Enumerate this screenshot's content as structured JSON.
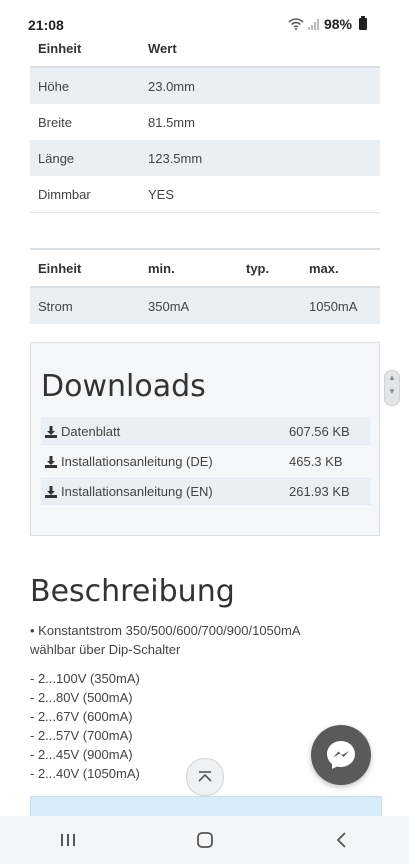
{
  "status_bar": {
    "time": "21:08",
    "battery": "98%"
  },
  "spec_table_1": {
    "headers": [
      "Einheit",
      "Wert"
    ],
    "rows": [
      [
        "Höhe",
        "23.0mm"
      ],
      [
        "Breite",
        "81.5mm"
      ],
      [
        "Länge",
        "123.5mm"
      ],
      [
        "Dimmbar",
        "YES"
      ]
    ]
  },
  "spec_table_2": {
    "headers": [
      "Einheit",
      "min.",
      "typ.",
      "max."
    ],
    "rows": [
      [
        "Strom",
        "350mA",
        "",
        "1050mA"
      ]
    ]
  },
  "downloads": {
    "title": "Downloads",
    "items": [
      {
        "name": "Datenblatt",
        "size": "607.56 KB"
      },
      {
        "name": "Installationsanleitung (DE)",
        "size": "465.3 KB"
      },
      {
        "name": "Installationsanleitung (EN)",
        "size": "261.93 KB"
      }
    ]
  },
  "description": {
    "title": "Beschreibung",
    "line1": "• Konstantstrom 350/500/600/700/900/1050mA",
    "line2": "wählbar über Dip-Schalter",
    "list": [
      "- 2...100V (350mA)",
      "- 2...80V (500mA)",
      "- 2...67V (600mA)",
      "- 2...57V (700mA)",
      "- 2...45V (900mA)",
      "- 2...40V (1050mA)"
    ]
  },
  "colors": {
    "row_alt": "#e9eff4",
    "messenger_bg": "#5a5a5a",
    "footer_panel": "#d7ecf6"
  },
  "icons": {
    "download": "download-icon",
    "messenger": "messenger-icon",
    "scroll_top": "chevron-up-icon"
  }
}
